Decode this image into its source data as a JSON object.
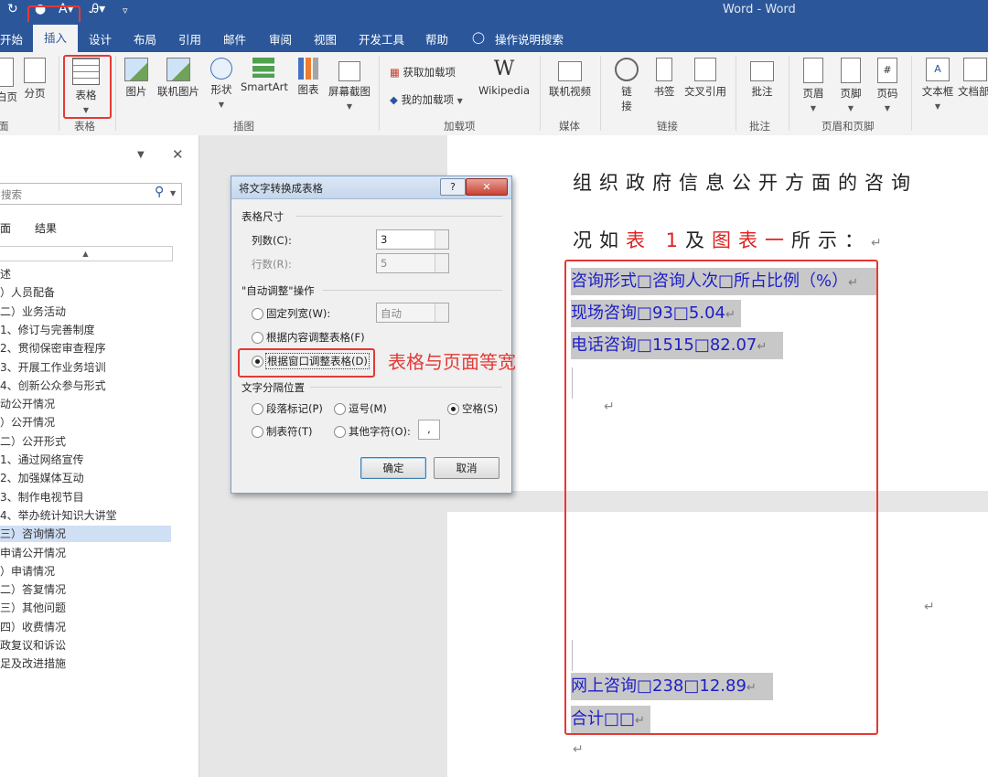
{
  "title_bar": {
    "app_title": "Word  -  Word"
  },
  "tabs": [
    "开始",
    "插入",
    "设计",
    "布局",
    "引用",
    "邮件",
    "审阅",
    "视图",
    "开发工具",
    "帮助",
    "操作说明搜索"
  ],
  "ribbon": {
    "buttons": {
      "blank_page": "白页",
      "page_break": "分页",
      "table": "表格",
      "picture": "图片",
      "online_picture": "联机图片",
      "shapes": "形状",
      "smartart": "SmartArt",
      "chart": "图表",
      "screenshot": "屏幕截图",
      "get_addins": "获取加载项",
      "my_addins": "我的加载项",
      "wikipedia": "Wikipedia",
      "online_video": "联机视频",
      "link": "链接",
      "bookmark": "书签",
      "cross_reference": "交叉引用",
      "comment": "批注",
      "header": "页眉",
      "footer": "页脚",
      "page_number": "页码",
      "text_box": "文本框",
      "doc_parts": "文档部"
    },
    "groups": {
      "pages": "面",
      "tables": "表格",
      "illustrations": "插图",
      "addins": "加载项",
      "media": "媒体",
      "links": "链接",
      "comments": "批注",
      "header_footer": "页眉和页脚"
    }
  },
  "nav": {
    "search_placeholder": "搜索",
    "tabs": [
      "面",
      "结果"
    ],
    "items": [
      "述",
      "）人员配备",
      "二）业务活动",
      "1、修订与完善制度",
      "2、贯彻保密审查程序",
      "3、开展工作业务培训",
      "4、创新公众参与形式",
      "动公开情况",
      "）公开情况",
      "二）公开形式",
      "1、通过网络宣传",
      "2、加强媒体互动",
      "3、制作电视节目",
      "4、举办统计知识大讲堂",
      "三）咨询情况",
      "申请公开情况",
      "）申请情况",
      "二）答复情况",
      "三）其他问题",
      "四）收费情况",
      "政复议和诉讼",
      "足及改进措施"
    ],
    "selected_index": 14
  },
  "dialog": {
    "title": "将文字转换成表格",
    "size_section": "表格尺寸",
    "cols_label": "列数(C):",
    "cols_value": "3",
    "rows_label": "行数(R):",
    "rows_value": "5",
    "autofit_section": "\"自动调整\"操作",
    "fixed_width": "固定列宽(W):",
    "fixed_value": "自动",
    "fit_content": "根据内容调整表格(F)",
    "fit_window": "根据窗口调整表格(D)",
    "separator_section": "文字分隔位置",
    "sep_paragraph": "段落标记(P)",
    "sep_comma": "逗号(M)",
    "sep_space": "空格(S)",
    "sep_tab": "制表符(T)",
    "sep_other": "其他字符(O):",
    "sep_other_value": ",",
    "ok": "确定",
    "cancel": "取消"
  },
  "annotation": {
    "text": "表格与页面等宽",
    "color": "#e53935"
  },
  "document": {
    "line1": "组织政府信息公开方面的咨询",
    "line2_a": "况如",
    "line2_b": "表 1",
    "line2_c": "及",
    "line2_d": "图表一",
    "line2_e": "所示：",
    "rows": [
      "咨询形式□咨询人次□所占比例（%）",
      "现场咨询□93□5.04",
      "电话咨询□1515□82.07",
      "网上咨询□238□12.89",
      "合计□□"
    ]
  },
  "colors": {
    "ribbon_blue": "#2b579a",
    "text_blue": "#1e1ec8",
    "accent_red": "#e53935"
  }
}
